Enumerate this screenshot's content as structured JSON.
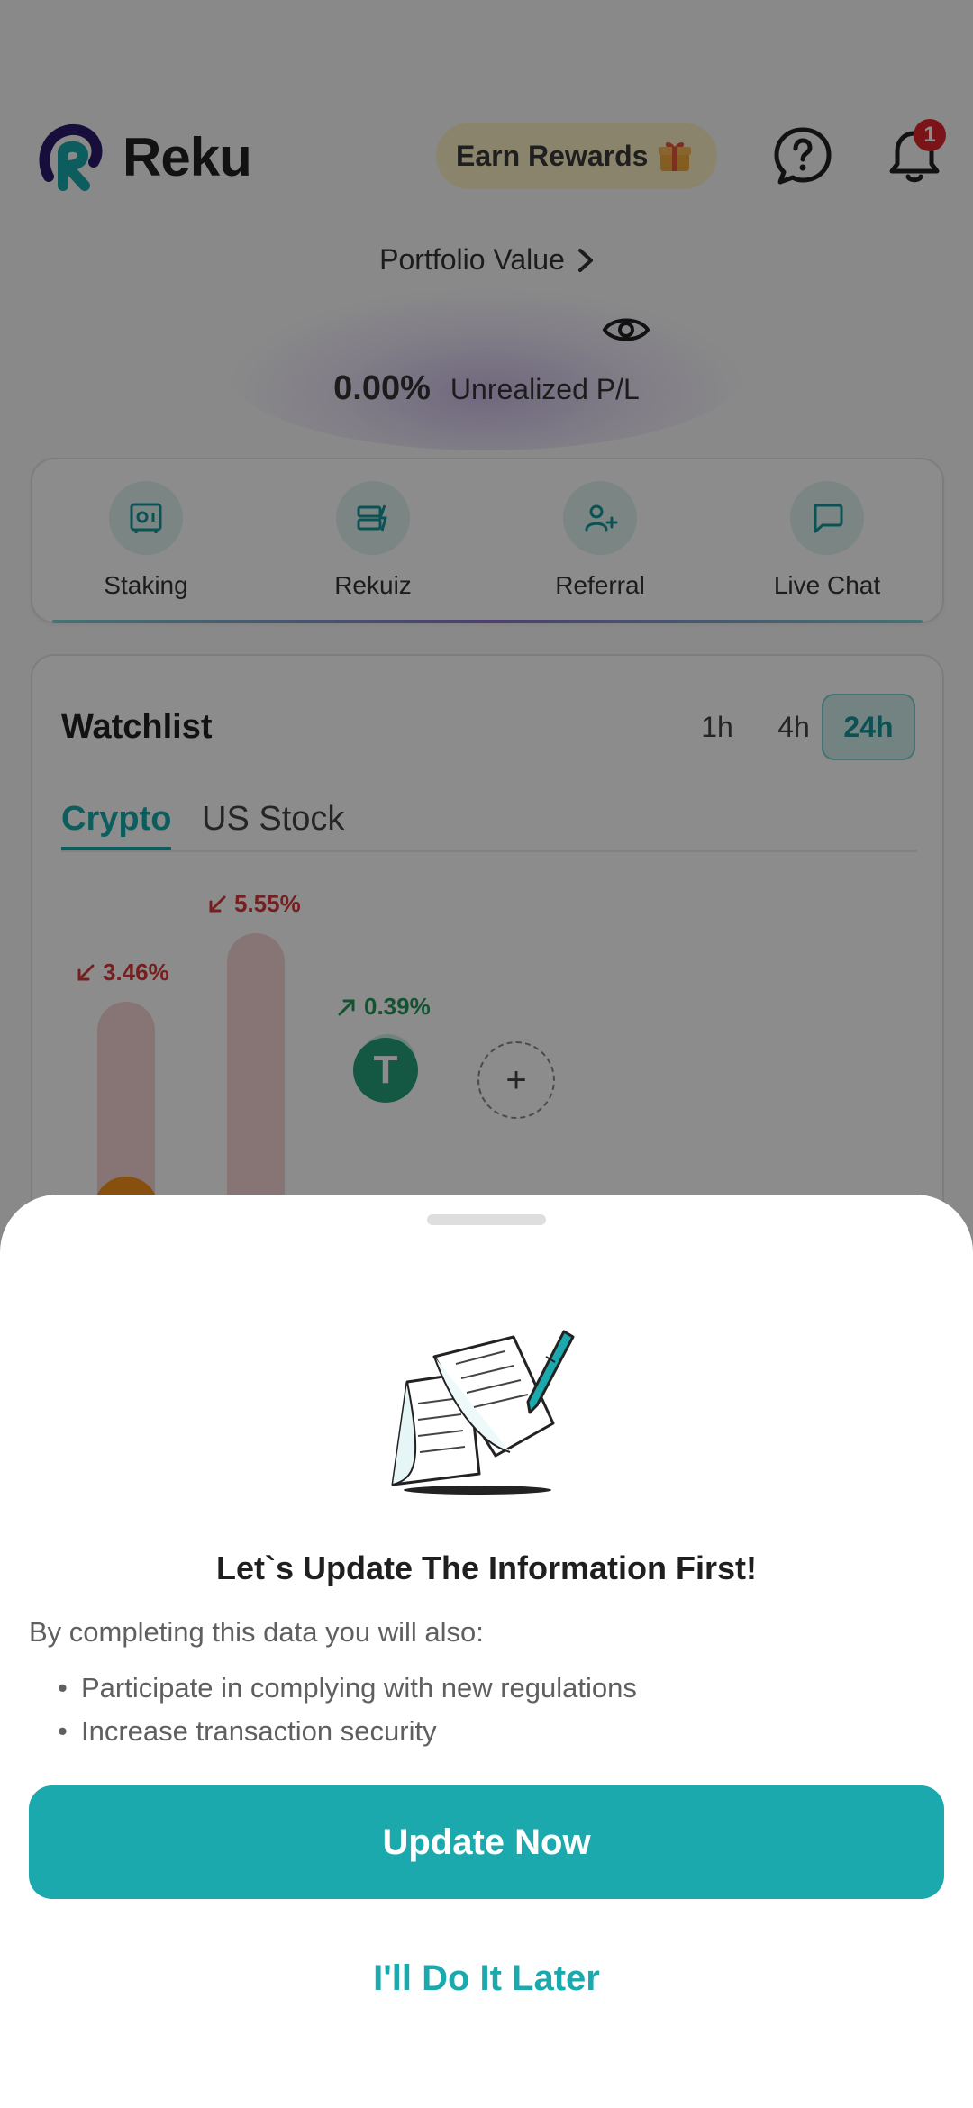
{
  "header": {
    "brand": "Reku",
    "earn_label": "Earn Rewards",
    "notification_count": "1",
    "brand_colors": {
      "primary": "#2a1a6e",
      "accent": "#1aa9ac"
    }
  },
  "portfolio": {
    "title": "Portfolio Value",
    "pl_percent": "0.00%",
    "pl_label": "Unrealized P/L"
  },
  "menu": {
    "items": [
      {
        "label": "Staking",
        "icon": "safe-icon"
      },
      {
        "label": "Rekuiz",
        "icon": "quiz-icon"
      },
      {
        "label": "Referral",
        "icon": "add-user-icon"
      },
      {
        "label": "Live Chat",
        "icon": "chat-icon"
      }
    ]
  },
  "watchlist": {
    "title": "Watchlist",
    "timeframes": [
      "1h",
      "4h",
      "24h"
    ],
    "selected_timeframe": "24h",
    "tabs": [
      "Crypto",
      "US Stock"
    ],
    "selected_tab": "Crypto",
    "coins": [
      {
        "change": "3.46%",
        "direction": "down"
      },
      {
        "change": "5.55%",
        "direction": "down"
      },
      {
        "change": "0.39%",
        "direction": "up"
      }
    ],
    "add_symbol": "+"
  },
  "sheet": {
    "title": "Let`s Update The Information First!",
    "intro": "By completing this data you will also:",
    "bullets": [
      "Participate in complying with new regulations",
      "Increase transaction security"
    ],
    "primary_button": "Update Now",
    "secondary_button": "I'll Do It Later",
    "colors": {
      "button": "#1ba9ad"
    }
  }
}
